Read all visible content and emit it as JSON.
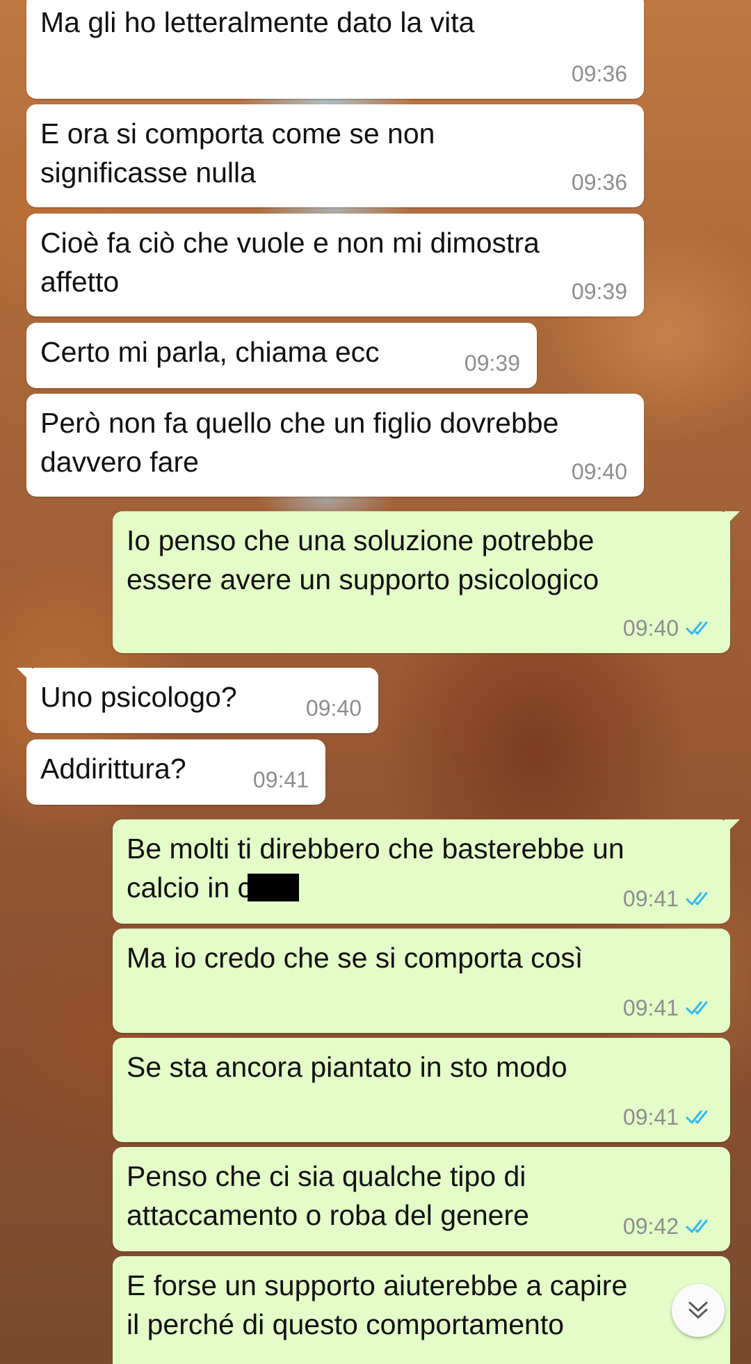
{
  "messages": [
    {
      "dir": "in",
      "text": "Ma gli ho letteralmente dato la vita",
      "time": "09:36"
    },
    {
      "dir": "in",
      "text": "E ora si comporta come se non\nsignificasse nulla",
      "time": "09:36"
    },
    {
      "dir": "in",
      "text": "Cioè fa ciò che vuole e non mi dimostra\naffetto",
      "time": "09:39"
    },
    {
      "dir": "in",
      "text": "Certo mi parla, chiama ecc",
      "time": "09:39"
    },
    {
      "dir": "in",
      "text": "Però non fa quello che un figlio dovrebbe\ndavvero fare",
      "time": "09:40"
    },
    {
      "dir": "out",
      "text": "Io penso che una soluzione potrebbe\nessere avere un supporto psicologico",
      "time": "09:40",
      "status": "read"
    },
    {
      "dir": "in",
      "text": "Uno psicologo?",
      "time": "09:40"
    },
    {
      "dir": "in",
      "text": "Addirittura?",
      "time": "09:41"
    },
    {
      "dir": "out",
      "text": "Be molti ti direbbero che basterebbe un\ncalcio in c",
      "time": "09:41",
      "status": "read",
      "redacted": true
    },
    {
      "dir": "out",
      "text": "Ma io credo che se si comporta così",
      "time": "09:41",
      "status": "read"
    },
    {
      "dir": "out",
      "text": "Se sta ancora piantato in sto modo",
      "time": "09:41",
      "status": "read"
    },
    {
      "dir": "out",
      "text": "Penso che ci sia qualche tipo di\nattaccamento o roba del genere",
      "time": "09:42",
      "status": "read"
    },
    {
      "dir": "out",
      "text": "E forse un supporto aiuterebbe a capire\nil perché di questo comportamento",
      "time": "",
      "status": ""
    }
  ],
  "colors": {
    "incoming_bubble": "#ffffff",
    "outgoing_bubble": "#e3fcc8",
    "read_ticks": "#34b7f1",
    "timestamp": "#8d8d8d"
  },
  "icons": {
    "read_status": "double-check-icon",
    "scroll_down": "chevron-double-down-icon"
  }
}
